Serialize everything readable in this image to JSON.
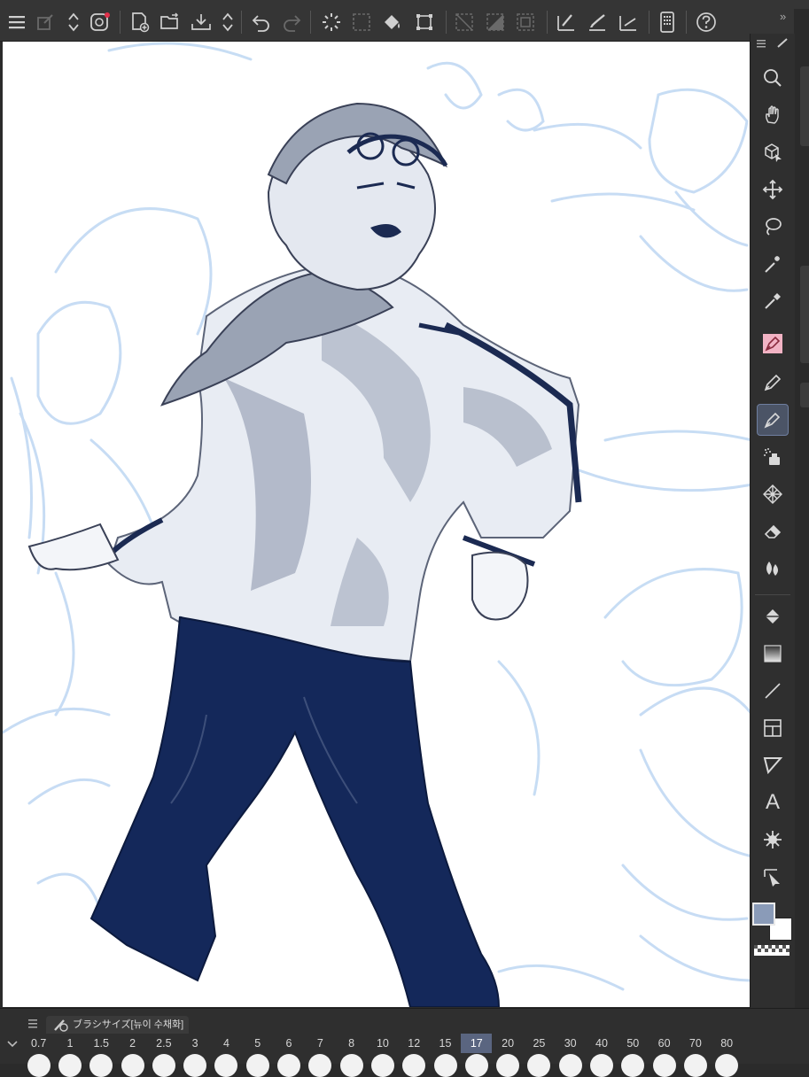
{
  "toolbar": {
    "icons": [
      "menu-icon",
      "transform-layer-icon",
      "sort-arrows-icon",
      "record-icon",
      "new-file-icon",
      "open-folder-icon",
      "save-icon",
      "save-arrows-icon",
      "undo-icon",
      "redo-icon",
      "loading-icon",
      "select-all-icon",
      "fill-icon",
      "crop-icon",
      "deselect-icon",
      "invert-selection-icon",
      "selection-border-icon",
      "ruler-pen-icon",
      "brush-ruler-icon",
      "line-ruler-icon",
      "phone-icon",
      "help-icon"
    ]
  },
  "tool_palette": {
    "tools": [
      "search-icon",
      "hand-icon",
      "3d-object-icon",
      "move-icon",
      "lasso-icon",
      "magic-wand-icon",
      "eyedropper-icon",
      "pen-icon",
      "pencil-icon",
      "brush-icon",
      "airbrush-icon",
      "decoration-icon",
      "eraser-icon",
      "blend-icon",
      "fill-icon",
      "gradient-icon",
      "line-icon",
      "frame-icon",
      "speech-balloon-icon",
      "text-icon",
      "correct-line-icon",
      "operation-icon"
    ],
    "active_tool": "brush-icon",
    "text_tool_glyph": "A"
  },
  "colors": {
    "main": "#8a9bb8",
    "sub": "#ffffff",
    "ink": "#1b2a52",
    "sketch": "#bcd6f2",
    "shade": "#a9b2c2"
  },
  "brush_palette": {
    "title": "ブラシサイズ[뉴이 수채화]",
    "sizes": [
      "0.7",
      "1",
      "1.5",
      "2",
      "2.5",
      "3",
      "4",
      "5",
      "6",
      "7",
      "8",
      "10",
      "12",
      "15",
      "17",
      "20",
      "25",
      "30",
      "40",
      "50",
      "60",
      "70",
      "80"
    ],
    "selected": "17"
  }
}
